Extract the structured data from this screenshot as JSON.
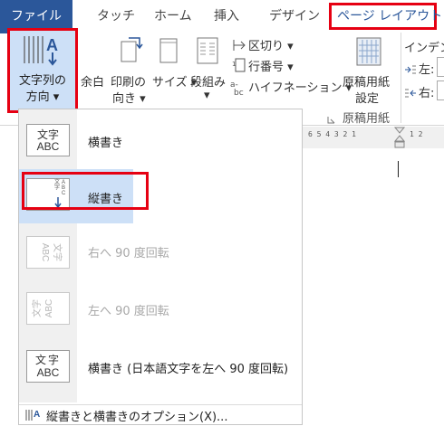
{
  "tabs": {
    "file": "ファイル",
    "items": [
      "タッチ",
      "ホーム",
      "挿入",
      "デザイン"
    ],
    "active": "ページ レイアウト"
  },
  "ribbon": {
    "text_direction": {
      "line1": "文字列の",
      "line2": "方向 ▾"
    },
    "margins": "余白",
    "orientation": {
      "line1": "印刷の",
      "line2": "向き ▾"
    },
    "size": "サイズ ▾",
    "columns": {
      "line1": "段組み",
      "line2": "▾"
    },
    "breaks": "区切り ▾",
    "line_numbers": "行番号 ▾",
    "hyphenation": "ハイフネーション ▾",
    "genko": {
      "line1": "原稿用紙",
      "line2": "設定"
    },
    "group_genko": "原稿用紙",
    "indent_title": "インデン",
    "indent_left": "左:",
    "indent_right": "右:"
  },
  "menu": {
    "items": [
      {
        "label": "横書き",
        "icon_top": "文字",
        "icon_bottom": "ABC",
        "state": "normal"
      },
      {
        "label": "縦書き",
        "icon_top": "文字",
        "icon_bottom": "ABC",
        "state": "selected"
      },
      {
        "label": "右へ 90 度回転",
        "icon_top": "文字",
        "icon_bottom": "ABC",
        "state": "disabled"
      },
      {
        "label": "左へ 90 度回転",
        "icon_top": "文字",
        "icon_bottom": "ABC",
        "state": "disabled"
      },
      {
        "label": "横書き (日本語文字を左へ 90 度回転)",
        "icon_top": "文字",
        "icon_bottom": "ABC",
        "state": "normal"
      }
    ],
    "footer": "縦書きと横書きのオプション(X)..."
  },
  "ruler": {
    "left_marks": "6 5 4 3 2 1",
    "right_marks": "1 2"
  },
  "colors": {
    "accent": "#2b579a",
    "highlight": "#e60012",
    "selected": "#cde0f7"
  }
}
